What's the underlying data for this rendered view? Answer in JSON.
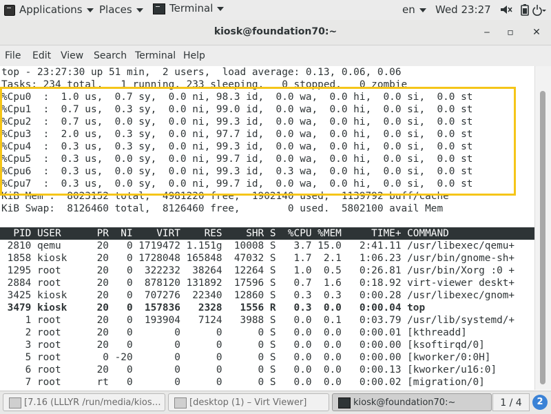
{
  "topbar": {
    "applications": "Applications",
    "places": "Places",
    "terminal": "Terminal",
    "lang": "en",
    "clock": "Wed 23:27"
  },
  "window": {
    "title": "kiosk@foundation70:~",
    "minimize": "‒",
    "maximize": "▫",
    "close": "✕"
  },
  "menubar": [
    "File",
    "Edit",
    "View",
    "Search",
    "Terminal",
    "Help"
  ],
  "terminal": {
    "summary": [
      "top - 23:27:30 up 51 min,  2 users,  load average: 0.13, 0.06, 0.06",
      "Tasks: 234 total,   1 running, 233 sleeping,   0 stopped,   0 zombie",
      "%Cpu0  :  1.0 us,  0.7 sy,  0.0 ni, 98.3 id,  0.0 wa,  0.0 hi,  0.0 si,  0.0 st",
      "%Cpu1  :  0.7 us,  0.3 sy,  0.0 ni, 99.0 id,  0.0 wa,  0.0 hi,  0.0 si,  0.0 st",
      "%Cpu2  :  0.7 us,  0.0 sy,  0.0 ni, 99.3 id,  0.0 wa,  0.0 hi,  0.0 si,  0.0 st",
      "%Cpu3  :  2.0 us,  0.3 sy,  0.0 ni, 97.7 id,  0.0 wa,  0.0 hi,  0.0 si,  0.0 st",
      "%Cpu4  :  0.3 us,  0.3 sy,  0.0 ni, 99.3 id,  0.0 wa,  0.0 hi,  0.0 si,  0.0 st",
      "%Cpu5  :  0.3 us,  0.0 sy,  0.0 ni, 99.7 id,  0.0 wa,  0.0 hi,  0.0 si,  0.0 st",
      "%Cpu6  :  0.3 us,  0.0 sy,  0.0 ni, 99.3 id,  0.3 wa,  0.0 hi,  0.0 si,  0.0 st",
      "%Cpu7  :  0.3 us,  0.0 sy,  0.0 ni, 99.7 id,  0.0 wa,  0.0 hi,  0.0 si,  0.0 st",
      "KiB Mem :  8023152 total,  4981220 free,  1902140 used,  1139792 buff/cache",
      "KiB Swap:  8126460 total,  8126460 free,        0 used.  5802100 avail Mem"
    ],
    "header": "  PID USER      PR  NI    VIRT    RES    SHR S  %CPU %MEM     TIME+ COMMAND",
    "processes": [
      {
        "text": " 2810 qemu      20   0 1719472 1.151g  10008 S   3.7 15.0   2:41.11 /usr/libexec/qemu+",
        "bold": false
      },
      {
        "text": " 1858 kiosk     20   0 1728048 165848  47032 S   1.7  2.1   1:06.23 /usr/bin/gnome-sh+",
        "bold": false
      },
      {
        "text": " 1295 root      20   0  322232  38264  12264 S   1.0  0.5   0:26.81 /usr/bin/Xorg :0 +",
        "bold": false
      },
      {
        "text": " 2884 root      20   0  878120 131892  17596 S   0.7  1.6   0:18.92 virt-viewer deskt+",
        "bold": false
      },
      {
        "text": " 3425 kiosk     20   0  707276  22340  12860 S   0.3  0.3   0:00.28 /usr/libexec/gnom+",
        "bold": false
      },
      {
        "text": " 3479 kiosk     20   0  157836   2328   1556 R   0.3  0.0   0:00.04 top",
        "bold": true
      },
      {
        "text": "    1 root      20   0  193904   7124   3988 S   0.0  0.1   0:03.79 /usr/lib/systemd/+",
        "bold": false
      },
      {
        "text": "    2 root      20   0       0      0      0 S   0.0  0.0   0:00.01 [kthreadd]",
        "bold": false
      },
      {
        "text": "    3 root      20   0       0      0      0 S   0.0  0.0   0:00.00 [ksoftirqd/0]",
        "bold": false
      },
      {
        "text": "    5 root       0 -20       0      0      0 S   0.0  0.0   0:00.00 [kworker/0:0H]",
        "bold": false
      },
      {
        "text": "    6 root      20   0       0      0      0 S   0.0  0.0   0:00.13 [kworker/u16:0]",
        "bold": false
      },
      {
        "text": "    7 root      rt   0       0      0      0 S   0.0  0.0   0:00.02 [migration/0]",
        "bold": false
      }
    ]
  },
  "taskbar": {
    "items": [
      {
        "label": "[7.16 (LLLYR /run/media/kios…",
        "active": false
      },
      {
        "label": "[desktop (1) – Virt Viewer]",
        "active": false
      },
      {
        "label": "kiosk@foundation70:~",
        "active": true
      }
    ],
    "pager": "1 / 4",
    "help": "2"
  },
  "colors": {
    "highlight": "#f5c518",
    "terminal_fg": "#2e3436",
    "header_bg": "#2e3436"
  },
  "icons": [
    "terminal-icon",
    "volume-icon",
    "battery-icon",
    "power-icon"
  ]
}
